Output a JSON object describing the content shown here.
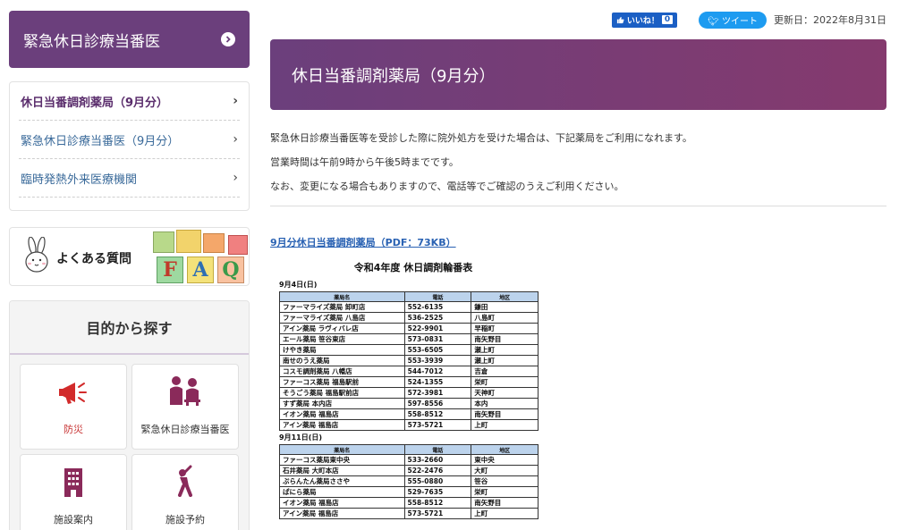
{
  "sidebar": {
    "header_title": "緊急休日診療当番医",
    "items": [
      {
        "label": "休日当番調剤薬局（9月分）",
        "active": true
      },
      {
        "label": "緊急休日診療当番医（9月分）",
        "active": false
      },
      {
        "label": "臨時発熱外来医療機関",
        "active": false
      }
    ],
    "faq_label": "よくある質問",
    "faq_blocks": [
      "F",
      "A",
      "Q"
    ],
    "purpose_title": "目的から探す",
    "tiles": [
      {
        "label": "防災",
        "icon": "megaphone-icon"
      },
      {
        "label": "緊急休日診療当番医",
        "icon": "doctor-icon"
      },
      {
        "label": "施設案内",
        "icon": "building-icon"
      },
      {
        "label": "施設予約",
        "icon": "baseball-player-icon"
      }
    ]
  },
  "header": {
    "like_label": "いいね！",
    "like_count": "0",
    "tweet_label": "ツイート",
    "updated": "更新日：2022年8月31日"
  },
  "main": {
    "title": "休日当番調剤薬局（9月分）",
    "intro": [
      "緊急休日診療当番医等を受診した際に院外処方を受けた場合は、下記薬局をご利用になれます。",
      "営業時間は午前9時から午後5時までです。",
      "なお、変更になる場合もありますので、電話等でご確認のうえご利用ください。"
    ],
    "pdf_link": "9月分休日当番調剤薬局（PDF：73KB）"
  },
  "document": {
    "title": "令和4年度 休日調剤輪番表",
    "headers": [
      "薬局名",
      "電話",
      "地区"
    ],
    "sections": [
      {
        "date": "9月4日(日)",
        "rows": [
          [
            "ファーマライズ薬局 卸町店",
            "552-6135",
            "鎌田"
          ],
          [
            "ファーマライズ薬局 八島店",
            "536-2525",
            "八島町"
          ],
          [
            "アイン薬局 ラヴィバレ店",
            "522-9901",
            "早稲町"
          ],
          [
            "エール薬局 笹谷東店",
            "573-0831",
            "南矢野目"
          ],
          [
            "けやき薬局",
            "553-6505",
            "瀬上町"
          ],
          [
            "南せのうえ薬局",
            "553-3939",
            "瀬上町"
          ],
          [
            "コスモ調剤薬局 八幡店",
            "544-7012",
            "吉倉"
          ],
          [
            "ファーコス薬局 福島駅前",
            "524-1355",
            "栄町"
          ],
          [
            "そうごう薬局 福島駅前店",
            "572-3981",
            "天神町"
          ],
          [
            "すず薬局 本内店",
            "597-8556",
            "本内"
          ],
          [
            "イオン薬局 福島店",
            "558-8512",
            "南矢野目"
          ],
          [
            "アイン薬局 福島店",
            "573-5721",
            "上町"
          ]
        ]
      },
      {
        "date": "9月11日(日)",
        "rows": [
          [
            "ファーコス薬局東中央",
            "533-2660",
            "東中央"
          ],
          [
            "石井薬局 大町本店",
            "522-2476",
            "大町"
          ],
          [
            "ぷらんたん薬局ささや",
            "555-0880",
            "笹谷"
          ],
          [
            "ぱにら薬局",
            "529-7635",
            "栄町"
          ],
          [
            "イオン薬局 福島店",
            "558-8512",
            "南矢野目"
          ],
          [
            "アイン薬局 福島店",
            "573-5721",
            "上町"
          ]
        ]
      }
    ]
  }
}
